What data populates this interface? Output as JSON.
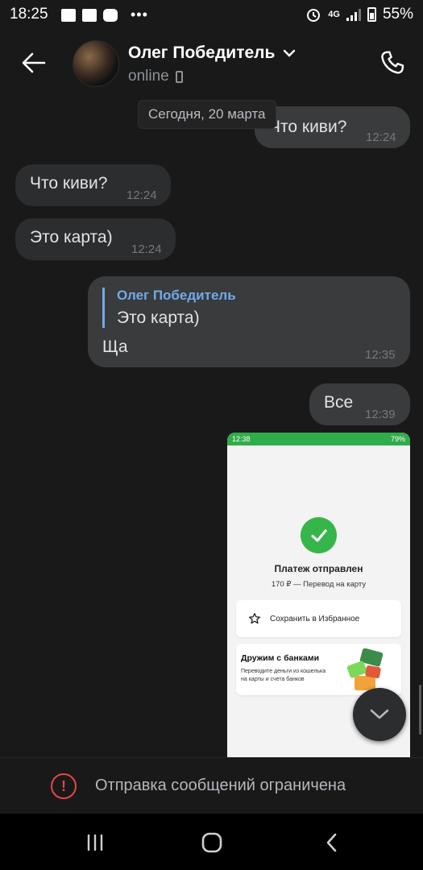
{
  "status_bar": {
    "time": "18:25",
    "network": "4G",
    "battery": "55%"
  },
  "header": {
    "contact_name": "Олег Победитель",
    "status": "online"
  },
  "chat": {
    "date_chip": "Сегодня, 20 марта",
    "messages": [
      {
        "dir": "out",
        "text": "Что киви?",
        "time": "12:24"
      },
      {
        "dir": "in",
        "text": "Что киви?",
        "time": "12:24"
      },
      {
        "dir": "in",
        "text": "Это карта)",
        "time": "12:24"
      },
      {
        "dir": "out",
        "reply_author": "Олег Победитель",
        "reply_text": "Это карта)",
        "text": "Ща",
        "time": "12:35"
      },
      {
        "dir": "out",
        "text": "Все",
        "time": "12:39"
      }
    ],
    "screenshot": {
      "time": "12:38",
      "battery": "79%",
      "title": "Платеж отправлен",
      "subtitle": "170 ₽ — Перевод на карту",
      "favorite_label": "Сохранить в Избранное",
      "bank_title": "Дружим с банками",
      "bank_desc": "Переводите деньги из кошелька на карты и счета банков"
    }
  },
  "restriction": {
    "text": "Отправка сообщений ограничена"
  },
  "colors": {
    "background": "#19191a",
    "bubble_in": "#2c2d2e",
    "bubble_out": "#3a3b3c",
    "accent": "#71aaeb",
    "warning": "#e64646",
    "success": "#36b54a"
  }
}
